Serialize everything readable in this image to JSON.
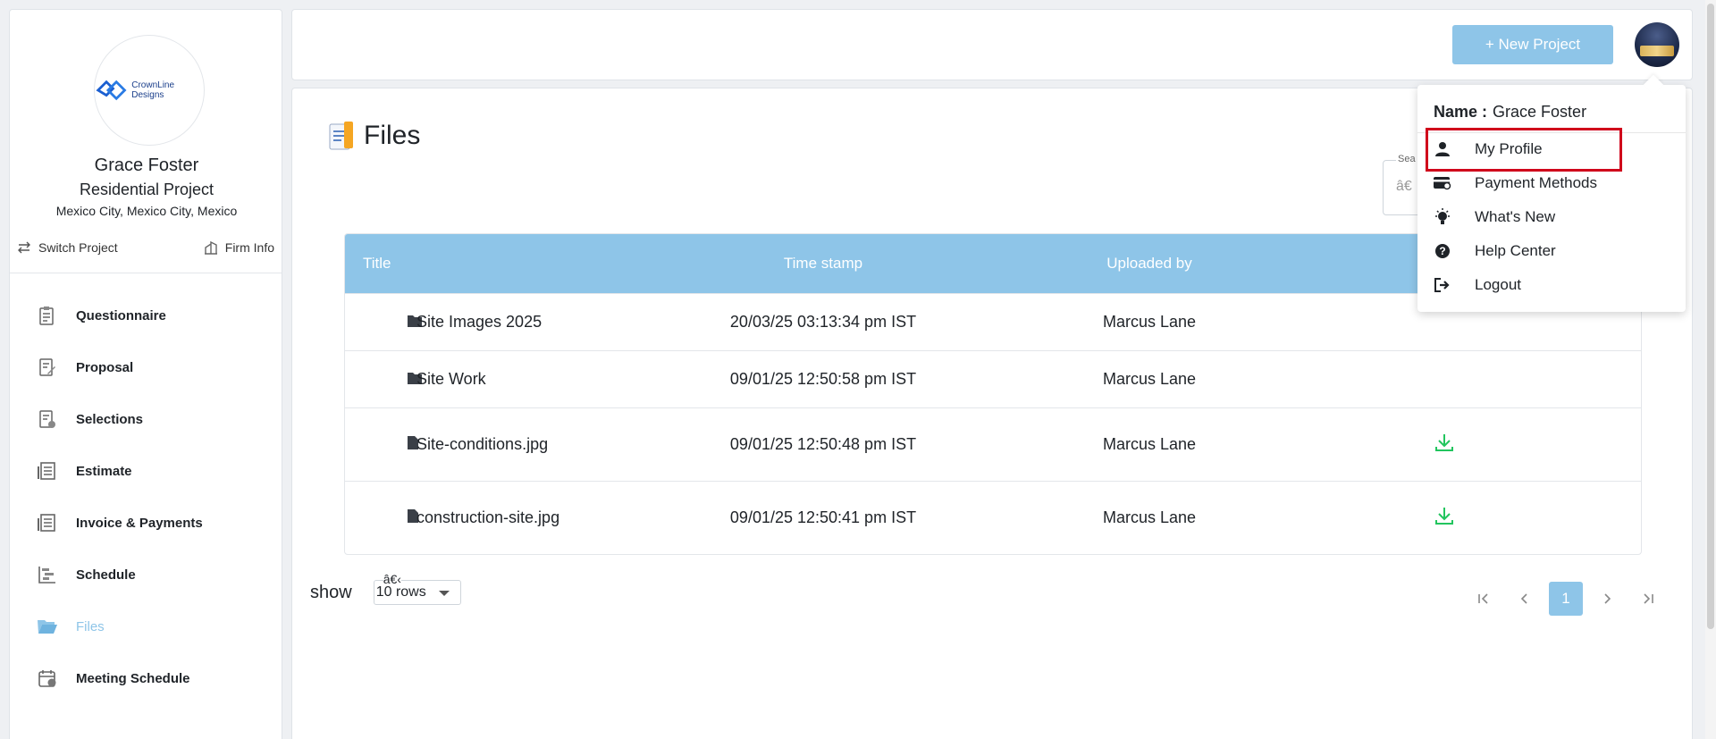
{
  "sidebar": {
    "logo_text": "CrownLine Designs",
    "name": "Grace Foster",
    "project": "Residential Project",
    "location": "Mexico City, Mexico City, Mexico",
    "switch_project": "Switch Project",
    "firm_info": "Firm Info",
    "nav": [
      {
        "label": "Questionnaire",
        "icon": "questionnaire-icon"
      },
      {
        "label": "Proposal",
        "icon": "proposal-icon"
      },
      {
        "label": "Selections",
        "icon": "selections-icon"
      },
      {
        "label": "Estimate",
        "icon": "estimate-icon"
      },
      {
        "label": "Invoice & Payments",
        "icon": "invoice-icon"
      },
      {
        "label": "Schedule",
        "icon": "schedule-icon"
      },
      {
        "label": "Files",
        "icon": "folder-open-icon",
        "active": true
      },
      {
        "label": "Meeting Schedule",
        "icon": "calendar-icon"
      }
    ]
  },
  "header": {
    "new_project_label": "+ New Project"
  },
  "main": {
    "title": "Files",
    "search": {
      "label": "Sea",
      "placeholder": "â€"
    },
    "table": {
      "headers": [
        "Title",
        "Time stamp",
        "Uploaded by"
      ],
      "rows": [
        {
          "type": "folder",
          "name": "Site Images 2025",
          "time": "20/03/25 03:13:34 pm IST",
          "uploaded_by": "Marcus Lane",
          "download": false
        },
        {
          "type": "folder",
          "name": "Site Work",
          "time": "09/01/25 12:50:58 pm IST",
          "uploaded_by": "Marcus Lane",
          "download": false
        },
        {
          "type": "file",
          "name": "Site-conditions.jpg",
          "time": "09/01/25 12:50:48 pm IST",
          "uploaded_by": "Marcus Lane",
          "download": true
        },
        {
          "type": "file",
          "name": "construction-site.jpg",
          "time": "09/01/25 12:50:41 pm IST",
          "uploaded_by": "Marcus Lane",
          "download": true
        }
      ]
    },
    "show_label": "show",
    "rows_select": {
      "value": "10 rows",
      "overlay": "â€‹"
    },
    "pagination": {
      "current": "1"
    }
  },
  "menu": {
    "name_label": "Name :",
    "name_value": "Grace Foster",
    "items": [
      {
        "label": "My Profile",
        "icon": "user-icon"
      },
      {
        "label": "Payment Methods",
        "icon": "credit-card-icon"
      },
      {
        "label": "What's New",
        "icon": "lightbulb-icon"
      },
      {
        "label": "Help Center",
        "icon": "help-circle-icon"
      },
      {
        "label": "Logout",
        "icon": "logout-icon"
      }
    ]
  },
  "colors": {
    "accent": "#8ec5e8",
    "download": "#22c55e",
    "highlight": "#d0021b"
  }
}
